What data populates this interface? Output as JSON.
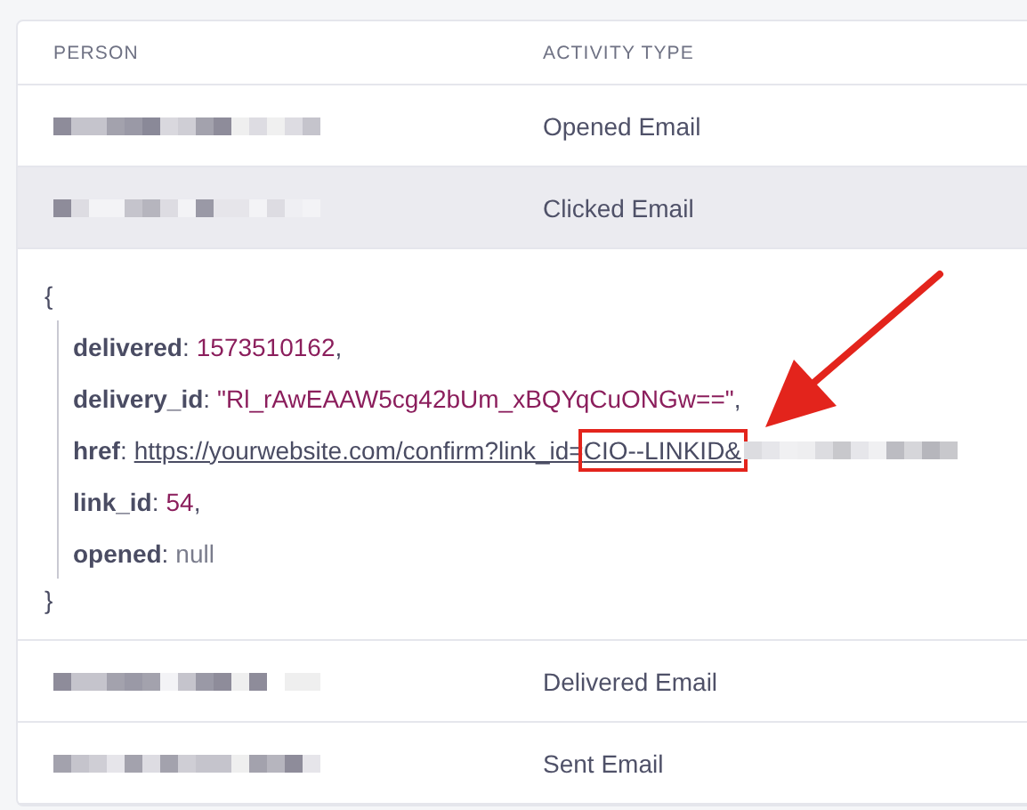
{
  "table": {
    "columns": [
      "PERSON",
      "ACTIVITY TYPE"
    ],
    "rows": [
      {
        "activity": "Opened Email",
        "selected": false
      },
      {
        "activity": "Clicked Email",
        "selected": true,
        "detail": {
          "open": "{",
          "close": "}",
          "fields": [
            {
              "key": "delivered",
              "separator": ":",
              "kind": "number",
              "value": "1573510162",
              "suffix": ","
            },
            {
              "key": "delivery_id",
              "separator": ":",
              "kind": "string",
              "value": "\"Rl_rAwEAAW5cg42bUm_xBQYqCuONGw==\"",
              "suffix": ","
            },
            {
              "key": "href",
              "separator": ":",
              "kind": "link",
              "value": "https://yourwebsite.com/confirm?link_id=",
              "highlight": "CIO--LINKID&"
            },
            {
              "key": "link_id",
              "separator": ":",
              "kind": "number",
              "value": "54",
              "suffix": ","
            },
            {
              "key": "opened",
              "separator": ":",
              "kind": "null",
              "value": "null"
            }
          ]
        }
      },
      {
        "activity": "Delivered Email",
        "selected": false
      },
      {
        "activity": "Sent Email",
        "selected": false
      }
    ]
  }
}
